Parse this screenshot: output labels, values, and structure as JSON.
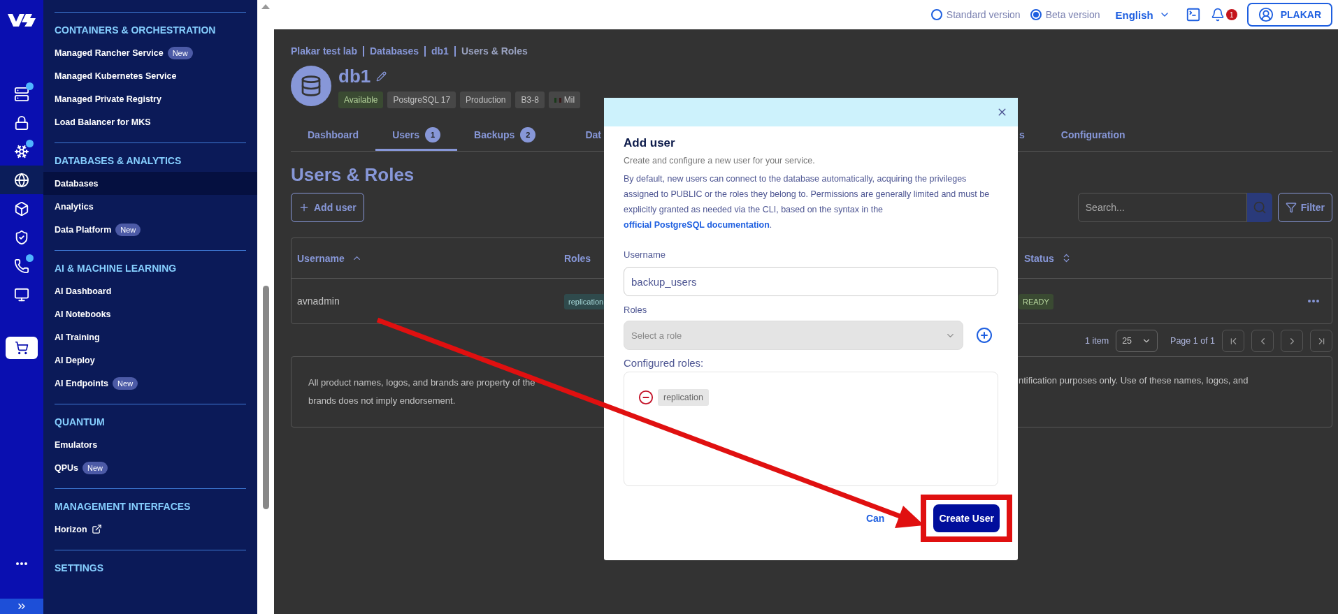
{
  "rail": {
    "items": [
      {
        "kind": "server",
        "dot": true,
        "selected": false
      },
      {
        "kind": "lock",
        "dot": false,
        "selected": false
      },
      {
        "kind": "snowflake",
        "dot": true,
        "selected": false
      },
      {
        "kind": "globe",
        "dot": false,
        "selected": true
      },
      {
        "kind": "box",
        "dot": false,
        "selected": false
      },
      {
        "kind": "shield",
        "dot": false,
        "selected": false
      },
      {
        "kind": "phone",
        "dot": true,
        "selected": false
      },
      {
        "kind": "monitor",
        "dot": false,
        "selected": false
      },
      {
        "kind": "cart",
        "selected": false
      }
    ],
    "bottom": [
      {
        "kind": "more"
      },
      {
        "kind": "expand"
      }
    ]
  },
  "nav": {
    "sections": [
      {
        "title": "CONTAINERS & ORCHESTRATION",
        "items": [
          {
            "label": "Managed Rancher Service",
            "badge": "New",
            "selected": false
          },
          {
            "label": "Managed Kubernetes Service",
            "selected": false
          },
          {
            "label": "Managed Private Registry",
            "selected": false
          },
          {
            "label": "Load Balancer for MKS",
            "selected": false
          }
        ]
      },
      {
        "title": "DATABASES & ANALYTICS",
        "items": [
          {
            "label": "Databases",
            "selected": true
          },
          {
            "label": "Analytics",
            "selected": false
          },
          {
            "label": "Data Platform",
            "badge": "New",
            "selected": false
          }
        ]
      },
      {
        "title": "AI & MACHINE LEARNING",
        "items": [
          {
            "label": "AI Dashboard",
            "selected": false
          },
          {
            "label": "AI Notebooks",
            "selected": false
          },
          {
            "label": "AI Training",
            "selected": false
          },
          {
            "label": "AI Deploy",
            "selected": false
          },
          {
            "label": "AI Endpoints",
            "badge": "New",
            "selected": false
          }
        ]
      },
      {
        "title": "QUANTUM",
        "items": [
          {
            "label": "Emulators",
            "selected": false
          },
          {
            "label": "QPUs",
            "badge": "New",
            "selected": false
          }
        ]
      },
      {
        "title": "MANAGEMENT INTERFACES",
        "items": [
          {
            "label": "Horizon",
            "external": true,
            "selected": false
          }
        ]
      },
      {
        "title": "SETTINGS"
      }
    ]
  },
  "header": {
    "versions": [
      {
        "label": "Standard version",
        "selected": false
      },
      {
        "label": "Beta version",
        "selected": true
      }
    ],
    "language": "English",
    "notifications": "1",
    "account": "PLAKAR"
  },
  "page": {
    "breadcrumb": [
      {
        "label": "Plakar test lab",
        "current": false
      },
      {
        "label": "Databases",
        "current": false
      },
      {
        "label": "db1",
        "current": false
      },
      {
        "label": "Users & Roles",
        "current": true
      }
    ],
    "title": "db1",
    "tags": [
      {
        "label": "Available",
        "kind": "status"
      },
      {
        "label": "PostgreSQL 17",
        "kind": "plain"
      },
      {
        "label": "Production",
        "kind": "plain"
      },
      {
        "label": "B3-8",
        "kind": "plain"
      },
      {
        "label": "Mil",
        "kind": "region"
      }
    ],
    "tabs": [
      {
        "label": "Dashboard",
        "selected": false
      },
      {
        "label": "Users",
        "badge": "1",
        "selected": true
      },
      {
        "label": "Backups",
        "badge": "2",
        "selected": false
      },
      {
        "label": "Dat",
        "selected": false
      }
    ],
    "tabs_right": [
      {
        "label": "s",
        "selected": false
      },
      {
        "label": "Configuration",
        "selected": false
      }
    ],
    "heading": "Users & Roles",
    "add_button": "Add user",
    "search": {
      "placeholder": "Search..."
    },
    "filter_button": "Filter",
    "columns": [
      {
        "label": "Username",
        "sorted": true
      },
      {
        "label": "Roles",
        "sorted": false,
        "sortable": false
      }
    ],
    "columns_right": [
      {
        "label": "Status",
        "sorted": false,
        "sortable": true
      }
    ],
    "rows": [
      {
        "username": "avnadmin",
        "role": "replication",
        "status": "READY"
      }
    ],
    "pagination": {
      "count": "1 item",
      "page_size": "25",
      "page": "Page 1 of 1"
    },
    "disclaimer": {
      "left": [
        "All product names, logos, and brands are property of the",
        "brands does not imply endorsement."
      ],
      "right": "ntification purposes only. Use of these names, logos, and"
    }
  },
  "modal": {
    "title": "Add user",
    "subtitle": "Create and configure a new user for your service.",
    "info": {
      "text": "By default, new users can connect to the database automatically, acquiring the privileges assigned to PUBLIC or the roles they belong to. Permissions are generally limited and must be explicitly granted as needed via the CLI, based on the syntax in the",
      "link": "official PostgreSQL documentation",
      "after": "."
    },
    "username_label": "Username",
    "username_value": "backup_users",
    "roles_label": "Roles",
    "roles_placeholder": "Select a role",
    "configured_label": "Configured roles:",
    "configured_roles": [
      "replication"
    ],
    "cancel": "Can",
    "submit": "Create User"
  },
  "annotations": {
    "arrow": true,
    "highlight_frame": true
  }
}
